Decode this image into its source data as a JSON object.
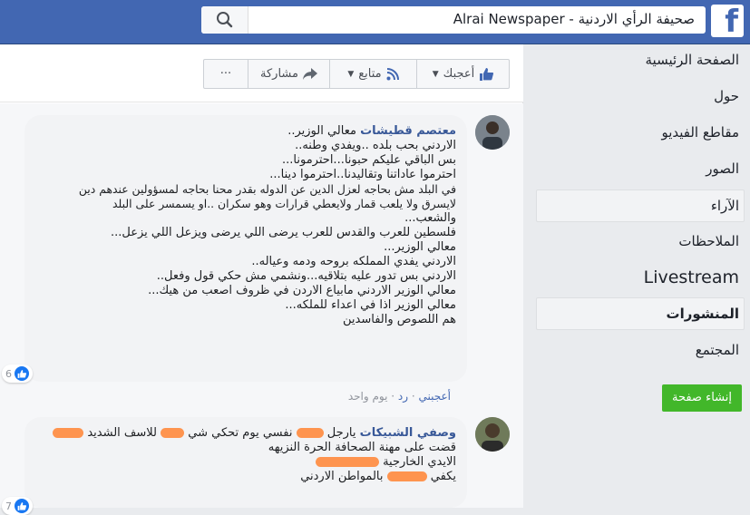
{
  "topbar": {
    "search_text": "صحيفة الرأي الاردنية - Alrai Newspaper",
    "logo_letter": "f"
  },
  "sidebar": {
    "items": [
      {
        "label": "الصفحة الرئيسية"
      },
      {
        "label": "حول"
      },
      {
        "label": "مقاطع الفيديو"
      },
      {
        "label": "الصور"
      },
      {
        "label": "الآراء"
      },
      {
        "label": "الملاحظات"
      },
      {
        "label": "Livestream"
      },
      {
        "label": "المنشورات"
      },
      {
        "label": "المجتمع"
      }
    ],
    "create_page_label": "إنشاء صفحة"
  },
  "actions": {
    "like": "أعجبك",
    "follow": "متابع",
    "share": "مشاركة",
    "more": "···"
  },
  "comments": [
    {
      "author": "معتصم قطيشات",
      "lines": [
        "معالي الوزير..",
        "الاردني بحب بلده ..ويفدي وطنه..",
        "بس الباقي عليكم حبونا...احترمونا...",
        "احترموا عاداتنا وتقاليدنا..احترموا دينا...",
        "في البلد مش بحاجه لعزل الدين عن الدوله بقدر محنا بحاجه لمسؤولين عندهم دين",
        "لايسرق ولا يلعب قمار ولايعطي قرارات وهو سكران ..او يسمسر على البلد",
        "والشعب...",
        "فلسطين للعرب والقدس للعرب يرضى اللي يرضى ويزعل اللي يزعل...",
        "معالي الوزير...",
        "الاردني يفدي المملكه بروحه ودمه وعياله..",
        "الاردني بس تدور عليه بتلاقيه...ونشمي مش حكي قول وفعل..",
        "معالي الوزير الاردني مابياع الاردن في ظروف اصعب من هيك...",
        "معالي الوزير اذا في اعداء للملكه...",
        "هم اللصوص والفاسدين"
      ],
      "likes": "6",
      "meta": {
        "like": "أعجبني",
        "reply": "رد",
        "time": "يوم واحد"
      }
    },
    {
      "author": "وصفي الشبيكات",
      "line1_a": "يارجل",
      "line1_b": "نفسي يوم تحكي شي",
      "line1_c": "للاسف الشديد",
      "lines": [
        "قضت على مهنة الصحافة الحرة النزيهه",
        "الايدي الخارجية",
        "يكفي",
        "بالمواطن الاردني"
      ],
      "likes": "7"
    }
  ],
  "colors": {
    "brand": "#4267b2",
    "link": "#385898",
    "green": "#42b72a"
  }
}
